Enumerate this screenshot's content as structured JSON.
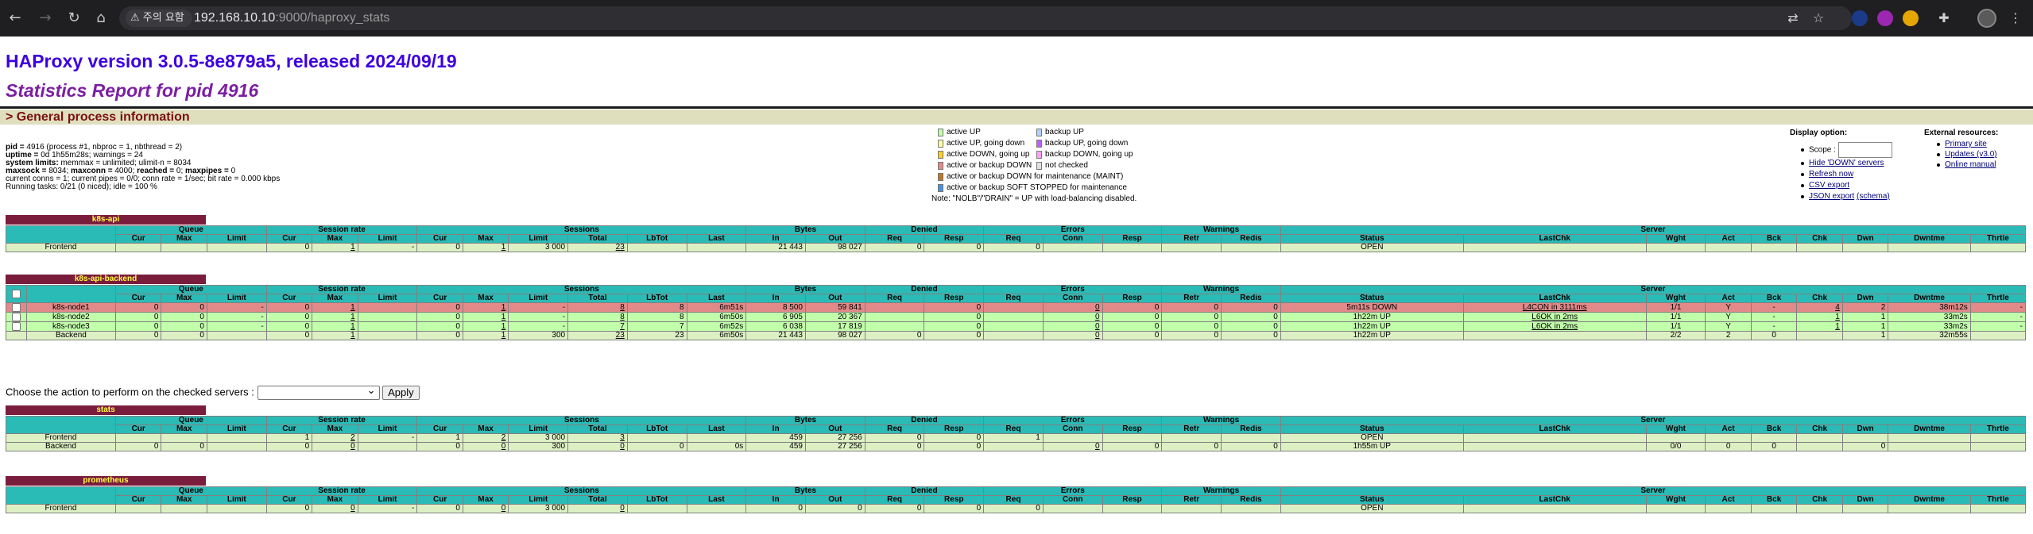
{
  "browser": {
    "warning": "주의 요함",
    "url_host": "192.168.10.10",
    "url_path": ":9000/haproxy_stats"
  },
  "page": {
    "title": "HAProxy version 3.0.5-8e879a5, released 2024/09/19",
    "subtitle": "Statistics Report for pid 4916",
    "section": "> General process information"
  },
  "process": {
    "l1_k": "pid = ",
    "l1_v": "4916 (process #1, nbproc = 1, nbthread = 2)",
    "l2_k": "uptime = ",
    "l2_v": "0d 1h55m28s; warnings = 24",
    "l3_k": "system limits:",
    "l3_v": " memmax = unlimited; ulimit-n = 8034",
    "l4_k1": "maxsock = ",
    "l4_v1": "8034; ",
    "l4_k2": "maxconn = ",
    "l4_v2": "4000; ",
    "l4_k3": "reached = ",
    "l4_v3": "0; ",
    "l4_k4": "maxpipes = ",
    "l4_v4": "0",
    "l5": "current conns = 1; current pipes = 0/0; conn rate = 1/sec; bit rate = 0.000 kbps",
    "l6": "Running tasks: 0/21 (0 niced); idle = 100 %"
  },
  "legend": {
    "active_up": "active UP",
    "active_up_going_down": "active UP, going down",
    "active_down_going_up": "active DOWN, going up",
    "active_or_backup_down": "active or backup DOWN",
    "maint": "active or backup DOWN for maintenance (MAINT)",
    "soft_stopped": "active or backup SOFT STOPPED for maintenance",
    "backup_up": "backup UP",
    "backup_up_going_down": "backup UP, going down",
    "backup_down_going_up": "backup DOWN, going up",
    "not_checked": "not checked",
    "note": "Note: \"NOLB\"/\"DRAIN\" = UP with load-balancing disabled."
  },
  "display_option": {
    "title": "Display option:",
    "scope_label": "Scope :",
    "hide_down": "Hide 'DOWN' servers",
    "refresh": "Refresh now",
    "csv": "CSV export",
    "json": "JSON export",
    "schema": "(schema)"
  },
  "external": {
    "title": "External resources:",
    "primary": "Primary site",
    "updates": "Updates (v3.0)",
    "manual": "Online manual"
  },
  "headers": {
    "groups": [
      "Queue",
      "Session rate",
      "Sessions",
      "Bytes",
      "Denied",
      "Errors",
      "Warnings",
      "Server"
    ],
    "cols": [
      "Cur",
      "Max",
      "Limit",
      "Cur",
      "Max",
      "Limit",
      "Cur",
      "Max",
      "Limit",
      "Total",
      "LbTot",
      "Last",
      "In",
      "Out",
      "Req",
      "Resp",
      "Req",
      "Conn",
      "Resp",
      "Retr",
      "Redis",
      "Status",
      "LastChk",
      "Wght",
      "Act",
      "Bck",
      "Chk",
      "Dwn",
      "Dwntme",
      "Thrtle"
    ]
  },
  "proxies": {
    "k8s_api": {
      "name": "k8s-api",
      "frontend": [
        "Frontend",
        "",
        "",
        "",
        "0",
        "1",
        "-",
        "0",
        "1",
        "3 000",
        "23",
        "",
        "",
        "21 443",
        "98 027",
        "0",
        "0",
        "0",
        "",
        "",
        "",
        "",
        "OPEN",
        "",
        "",
        "",
        "",
        "",
        "",
        "",
        ""
      ]
    },
    "k8s_api_backend": {
      "name": "k8s-api-backend",
      "node1": [
        "k8s-node1",
        "0",
        "0",
        "-",
        "0",
        "1",
        "",
        "0",
        "1",
        "-",
        "8",
        "8",
        "6m51s",
        "8 500",
        "59 841",
        "",
        "0",
        "",
        "0",
        "0",
        "0",
        "0",
        "5m11s DOWN",
        "L4CON in 3111ms",
        "1/1",
        "Y",
        "-",
        "4",
        "2",
        "38m12s",
        "-"
      ],
      "node2": [
        "k8s-node2",
        "0",
        "0",
        "-",
        "0",
        "1",
        "",
        "0",
        "1",
        "-",
        "8",
        "8",
        "6m50s",
        "6 905",
        "20 367",
        "",
        "0",
        "",
        "0",
        "0",
        "0",
        "0",
        "1h22m UP",
        "L6OK in 2ms",
        "1/1",
        "Y",
        "-",
        "1",
        "1",
        "33m2s",
        "-"
      ],
      "node3": [
        "k8s-node3",
        "0",
        "0",
        "-",
        "0",
        "1",
        "",
        "0",
        "1",
        "-",
        "7",
        "7",
        "6m52s",
        "6 038",
        "17 819",
        "",
        "0",
        "",
        "0",
        "0",
        "0",
        "0",
        "1h22m UP",
        "L6OK in 2ms",
        "1/1",
        "Y",
        "-",
        "1",
        "1",
        "33m2s",
        "-"
      ],
      "backend": [
        "Backend",
        "0",
        "0",
        "",
        "0",
        "1",
        "",
        "0",
        "1",
        "300",
        "23",
        "23",
        "6m50s",
        "21 443",
        "98 027",
        "0",
        "0",
        "",
        "0",
        "0",
        "0",
        "0",
        "1h22m UP",
        "",
        "2/2",
        "2",
        "0",
        "",
        "1",
        "32m55s",
        ""
      ]
    },
    "stats": {
      "name": "stats",
      "frontend": [
        "Frontend",
        "",
        "",
        "",
        "1",
        "2",
        "-",
        "1",
        "2",
        "3 000",
        "3",
        "",
        "",
        "459",
        "27 256",
        "0",
        "0",
        "1",
        "",
        "",
        "",
        "",
        "OPEN",
        "",
        "",
        "",
        "",
        "",
        "",
        "",
        ""
      ],
      "backend": [
        "Backend",
        "0",
        "0",
        "",
        "0",
        "0",
        "",
        "0",
        "0",
        "300",
        "0",
        "0",
        "0s",
        "459",
        "27 256",
        "0",
        "0",
        "",
        "0",
        "0",
        "0",
        "0",
        "1h55m UP",
        "",
        "0/0",
        "0",
        "0",
        "",
        "0",
        "",
        ""
      ]
    },
    "prometheus": {
      "name": "prometheus",
      "frontend": [
        "Frontend",
        "",
        "",
        "",
        "0",
        "0",
        "-",
        "0",
        "0",
        "3 000",
        "0",
        "",
        "",
        "0",
        "0",
        "0",
        "0",
        "0",
        "",
        "",
        "",
        "",
        "OPEN",
        "",
        "",
        "",
        "",
        "",
        "",
        "",
        ""
      ]
    }
  },
  "action": {
    "label": "Choose the action to perform on the checked servers : ",
    "apply": "Apply"
  },
  "colors": {
    "title": "#3d00e0",
    "subtitle": "#7b1fa2",
    "proxy_bg": "#7a1d3c",
    "header_bg": "#2bbbb6",
    "frontend_bg": "#ddf0c4",
    "down_bg": "#e28a8a",
    "up_bg": "#c2ffab"
  }
}
